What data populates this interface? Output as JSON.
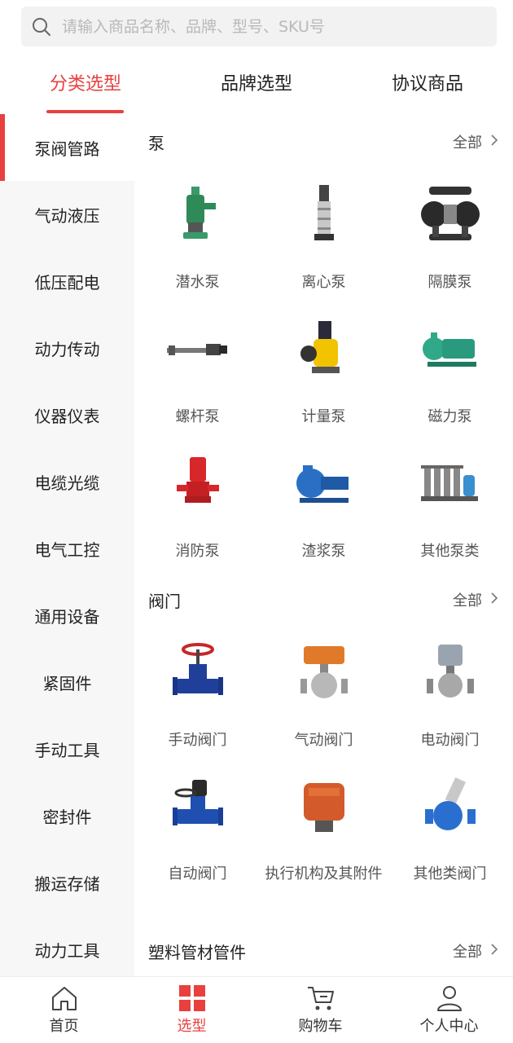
{
  "search": {
    "placeholder": "请输入商品名称、品牌、型号、SKU号"
  },
  "tabs": [
    {
      "label": "分类选型",
      "active": true
    },
    {
      "label": "品牌选型",
      "active": false
    },
    {
      "label": "协议商品",
      "active": false
    }
  ],
  "sidebar": {
    "items": [
      {
        "label": "泵阀管路",
        "active": true
      },
      {
        "label": "气动液压"
      },
      {
        "label": "低压配电"
      },
      {
        "label": "动力传动"
      },
      {
        "label": "仪器仪表"
      },
      {
        "label": "电缆光缆"
      },
      {
        "label": "电气工控"
      },
      {
        "label": "通用设备"
      },
      {
        "label": "紧固件"
      },
      {
        "label": "手动工具"
      },
      {
        "label": "密封件"
      },
      {
        "label": "搬运存储"
      },
      {
        "label": "动力工具"
      }
    ]
  },
  "sections": [
    {
      "title": "泵",
      "all_label": "全部",
      "items": [
        {
          "label": "潜水泵",
          "icon": "submersible-pump-image"
        },
        {
          "label": "离心泵",
          "icon": "centrifugal-pump-image"
        },
        {
          "label": "隔膜泵",
          "icon": "diaphragm-pump-image"
        },
        {
          "label": "螺杆泵",
          "icon": "screw-pump-image"
        },
        {
          "label": "计量泵",
          "icon": "metering-pump-image"
        },
        {
          "label": "磁力泵",
          "icon": "magnetic-pump-image"
        },
        {
          "label": "消防泵",
          "icon": "fire-pump-image"
        },
        {
          "label": "渣浆泵",
          "icon": "slurry-pump-image"
        },
        {
          "label": "其他泵类",
          "icon": "other-pumps-image"
        }
      ]
    },
    {
      "title": "阀门",
      "all_label": "全部",
      "items": [
        {
          "label": "手动阀门",
          "icon": "manual-valve-image"
        },
        {
          "label": "气动阀门",
          "icon": "pneumatic-valve-image"
        },
        {
          "label": "电动阀门",
          "icon": "electric-valve-image"
        },
        {
          "label": "自动阀门",
          "icon": "automatic-valve-image"
        },
        {
          "label": "执行机构及其附件",
          "icon": "actuator-image"
        },
        {
          "label": "其他类阀门",
          "icon": "other-valves-image"
        }
      ]
    },
    {
      "title": "塑料管材管件",
      "all_label": "全部",
      "items": []
    }
  ],
  "bottom_nav": [
    {
      "label": "首页",
      "icon": "home-icon",
      "active": false
    },
    {
      "label": "选型",
      "icon": "grid-icon",
      "active": true
    },
    {
      "label": "购物车",
      "icon": "cart-icon",
      "active": false
    },
    {
      "label": "个人中心",
      "icon": "user-icon",
      "active": false
    }
  ],
  "colors": {
    "accent": "#e8403f",
    "sidebar_bg": "#f7f7f7",
    "search_bg": "#f2f2f2"
  }
}
